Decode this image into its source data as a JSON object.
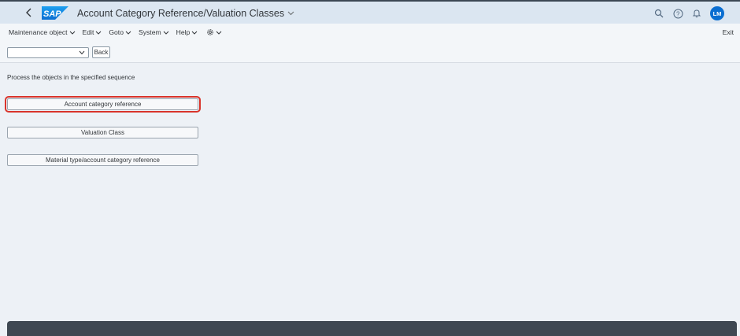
{
  "shell": {
    "logo_text": "SAP",
    "title": "Account Category Reference/Valuation Classes",
    "avatar_initials": "LM",
    "icons": [
      "back-icon",
      "search-icon",
      "help-icon",
      "notification-bell-icon"
    ]
  },
  "menu": {
    "items": [
      "Maintenance object",
      "Edit",
      "Goto",
      "System",
      "Help"
    ],
    "settings_icon": "gear-icon",
    "exit_label": "Exit"
  },
  "toolbar": {
    "dropdown_value": "",
    "back_label": "Back"
  },
  "content": {
    "instruction": "Process the objects in the specified sequence",
    "steps": [
      "Account category reference",
      "Valuation Class",
      "Material type/account category reference"
    ]
  },
  "colors": {
    "shell_bg": "#dbe6f1",
    "page_bg": "#edf1f6",
    "accent": "#0a6ed1",
    "highlight": "#d9342b",
    "footer": "#3f4852"
  }
}
